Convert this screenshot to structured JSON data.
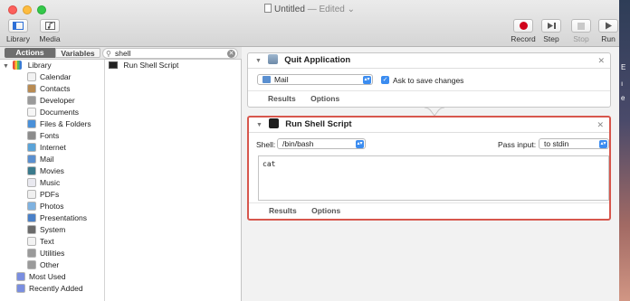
{
  "window": {
    "title": "Untitled",
    "edited": "— Edited",
    "edited_caret": "⌄"
  },
  "toolbar": {
    "library_label": "Library",
    "media_label": "Media",
    "record_label": "Record",
    "step_label": "Step",
    "stop_label": "Stop",
    "run_label": "Run"
  },
  "tabs": {
    "actions": "Actions",
    "variables": "Variables"
  },
  "search": {
    "value": "shell"
  },
  "library": {
    "root": "Library",
    "items": [
      {
        "label": "Calendar",
        "icon": "calendar-icon",
        "color": "#f2f2f2"
      },
      {
        "label": "Contacts",
        "icon": "contacts-icon",
        "color": "#b98b52"
      },
      {
        "label": "Developer",
        "icon": "developer-icon",
        "color": "#9a9a9a"
      },
      {
        "label": "Documents",
        "icon": "documents-icon",
        "color": "#f6f6f6"
      },
      {
        "label": "Files & Folders",
        "icon": "finder-icon",
        "color": "#4a90d9"
      },
      {
        "label": "Fonts",
        "icon": "fonts-icon",
        "color": "#8c8c8c"
      },
      {
        "label": "Internet",
        "icon": "internet-icon",
        "color": "#5aa3d8"
      },
      {
        "label": "Mail",
        "icon": "mail-icon",
        "color": "#5a8fd0"
      },
      {
        "label": "Movies",
        "icon": "movies-icon",
        "color": "#3a7a8c"
      },
      {
        "label": "Music",
        "icon": "music-icon",
        "color": "#e9e9f0"
      },
      {
        "label": "PDFs",
        "icon": "pdfs-icon",
        "color": "#f0f0f0"
      },
      {
        "label": "Photos",
        "icon": "photos-icon",
        "color": "#7fb2e0"
      },
      {
        "label": "Presentations",
        "icon": "presentations-icon",
        "color": "#4a80c8"
      },
      {
        "label": "System",
        "icon": "system-icon",
        "color": "#6b6b6b"
      },
      {
        "label": "Text",
        "icon": "text-icon",
        "color": "#f3f3f3"
      },
      {
        "label": "Utilities",
        "icon": "utilities-icon",
        "color": "#9a9a9a"
      },
      {
        "label": "Other",
        "icon": "other-icon",
        "color": "#9a9a9a"
      }
    ],
    "top_items": [
      {
        "label": "Most Used",
        "icon": "folder-icon",
        "color": "#7a8ee0"
      },
      {
        "label": "Recently Added",
        "icon": "folder-icon",
        "color": "#7a8ee0"
      }
    ]
  },
  "results": [
    {
      "label": "Run Shell Script",
      "icon": "terminal-icon"
    }
  ],
  "workflow": {
    "quit": {
      "title": "Quit Application",
      "app_value": "Mail",
      "ask_label": "Ask to save changes",
      "ask_checked": true,
      "results_label": "Results",
      "options_label": "Options"
    },
    "shell": {
      "title": "Run Shell Script",
      "shell_label": "Shell:",
      "shell_value": "/bin/bash",
      "pass_label": "Pass input:",
      "pass_value": "to stdin",
      "script_text": "cat",
      "results_label": "Results",
      "options_label": "Options"
    }
  },
  "colors": {
    "accent": "#3b8cf0",
    "selection_border": "#d7574d",
    "record": "#d0021b"
  }
}
